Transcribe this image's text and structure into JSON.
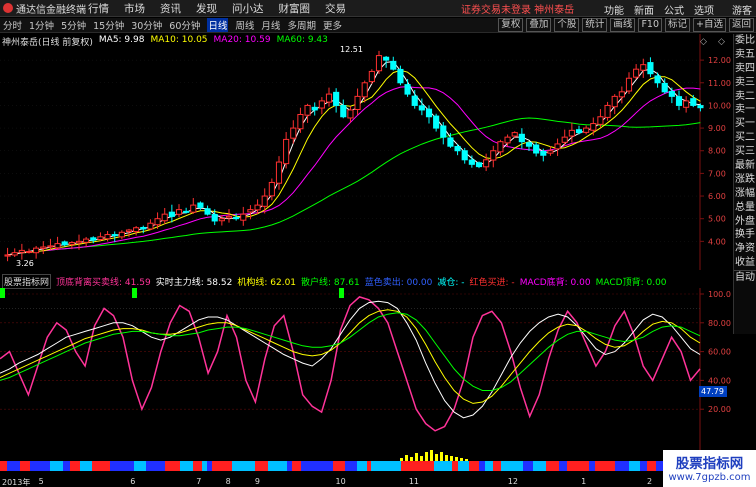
{
  "topbar": {
    "app_name": "通达信金融终端",
    "menu": [
      "行情",
      "市场",
      "资讯",
      "发现",
      "问小达",
      "财富圈",
      "交易"
    ],
    "notice": "证券交易未登录  神州泰岳",
    "right": [
      "功能",
      "新面",
      "公式",
      "选项",
      "游客"
    ]
  },
  "toolbar": {
    "periods": [
      "分时",
      "1分钟",
      "5分钟",
      "15分钟",
      "30分钟",
      "60分钟",
      "日线",
      "周线",
      "月线",
      "多周期",
      "更多"
    ],
    "selected_period": "日线",
    "tools": [
      "复权",
      "叠加",
      "个股",
      "统计",
      "画线",
      "F10",
      "标记",
      "+自选",
      "返回"
    ]
  },
  "main": {
    "stock_title": "神州泰岳(日线 前复权)",
    "ma": [
      {
        "label": "MA5: 9.98",
        "color": "#ffffff"
      },
      {
        "label": "MA10: 10.05",
        "color": "#ffff00"
      },
      {
        "label": "MA20: 10.59",
        "color": "#ff00ff"
      },
      {
        "label": "MA60: 9.43",
        "color": "#00ff00"
      }
    ],
    "high_label": "12.51",
    "low_label": "3.26",
    "y_ticks": [
      "12.00",
      "11.00",
      "10.00",
      "9.00",
      "8.00",
      "7.00",
      "6.00",
      "5.00",
      "4.00"
    ]
  },
  "indicator": {
    "name": "股票指标网",
    "items": [
      {
        "label": "顶底背离买卖线: 41.59",
        "color": "#ff3399"
      },
      {
        "label": "实时主力线: 58.52",
        "color": "#ffffff"
      },
      {
        "label": "机构线: 62.01",
        "color": "#ffff00"
      },
      {
        "label": "散户线: 87.61",
        "color": "#00ff00"
      },
      {
        "label": "蓝色卖出: 00.00",
        "color": "#3060ff"
      },
      {
        "label": "减仓: -",
        "color": "#00ffff"
      },
      {
        "label": "红色买进: -",
        "color": "#ff3030"
      },
      {
        "label": "MACD底背: 0.00",
        "color": "#ff00ff"
      },
      {
        "label": "MACD顶背: 0.00",
        "color": "#00ff00"
      }
    ],
    "y_ticks": [
      "100.0",
      "80.00",
      "60.00",
      "40.00",
      "20.00"
    ],
    "current_value": "47.79"
  },
  "sidebar": [
    "委比",
    "卖五",
    "卖四",
    "卖三",
    "卖二",
    "卖一",
    "买一",
    "买二",
    "买三",
    "最新",
    "涨跌",
    "涨幅",
    "总量",
    "外盘",
    "换手",
    "净资",
    "收益",
    "自动"
  ],
  "date_axis": [
    {
      "label": "2013年",
      "pos": 0.0
    },
    {
      "label": "5",
      "pos": 0.05
    },
    {
      "label": "6",
      "pos": 0.175
    },
    {
      "label": "7",
      "pos": 0.265
    },
    {
      "label": "8",
      "pos": 0.305
    },
    {
      "label": "9",
      "pos": 0.345
    },
    {
      "label": "10",
      "pos": 0.455
    },
    {
      "label": "11",
      "pos": 0.555
    },
    {
      "label": "12",
      "pos": 0.69
    },
    {
      "label": "1",
      "pos": 0.79
    },
    {
      "label": "2",
      "pos": 0.88
    }
  ],
  "watermark": {
    "title": "股票指标网",
    "url": "www.7gpzb.com"
  },
  "colors": {
    "up": "#ff3030",
    "down": "#00ffff",
    "ma5": "#ffffff",
    "ma10": "#ffff00",
    "ma20": "#ff00ff",
    "ma60": "#00ff00",
    "bg": "#000000"
  },
  "chart_data": [
    {
      "type": "candlestick",
      "ylim": [
        3.0,
        12.8
      ],
      "close": [
        3.4,
        3.5,
        3.6,
        3.55,
        3.7,
        3.75,
        3.8,
        3.9,
        3.85,
        3.95,
        4.0,
        4.1,
        4.05,
        4.2,
        4.3,
        4.25,
        4.4,
        4.5,
        4.6,
        4.55,
        4.8,
        5.0,
        5.2,
        5.1,
        5.4,
        5.3,
        5.6,
        5.5,
        5.2,
        4.9,
        5.0,
        5.1,
        5.0,
        5.2,
        5.4,
        5.6,
        6.0,
        6.6,
        7.5,
        8.5,
        9.0,
        9.6,
        10.0,
        9.8,
        10.2,
        10.5,
        10.0,
        9.5,
        9.8,
        10.4,
        11.0,
        11.5,
        12.2,
        12.0,
        11.6,
        11.0,
        10.5,
        10.0,
        9.8,
        9.5,
        9.0,
        8.6,
        8.2,
        8.0,
        7.6,
        7.4,
        7.3,
        7.6,
        8.0,
        8.4,
        8.6,
        8.8,
        8.4,
        8.2,
        7.9,
        7.8,
        8.0,
        8.3,
        8.6,
        8.9,
        8.8,
        9.0,
        9.2,
        9.5,
        10.0,
        10.4,
        10.6,
        11.2,
        11.6,
        11.8,
        11.4,
        11.0,
        10.6,
        10.4,
        10.0,
        10.2,
        10.0,
        9.9
      ]
    },
    {
      "type": "line",
      "ylim": [
        0,
        100
      ],
      "series": [
        {
          "name": "顶底背离买卖线",
          "values": [
            55,
            60,
            45,
            30,
            50,
            70,
            80,
            75,
            60,
            50,
            78,
            90,
            85,
            70,
            40,
            20,
            35,
            60,
            80,
            92,
            88,
            70,
            45,
            60,
            85,
            70,
            40,
            25,
            55,
            78,
            85,
            60,
            30,
            22,
            18,
            40,
            75,
            92,
            98,
            96,
            90,
            80,
            60,
            40,
            20,
            10,
            5,
            8,
            20,
            40,
            70,
            85,
            88,
            80,
            60,
            35,
            15,
            30,
            55,
            75,
            88,
            80,
            65,
            50,
            60,
            78,
            88,
            72,
            50,
            40,
            55,
            70,
            60,
            40,
            48
          ]
        },
        {
          "name": "实时主力线",
          "values": [
            45,
            48,
            52,
            55,
            58,
            62,
            66,
            70,
            72,
            74,
            76,
            78,
            80,
            80,
            78,
            74,
            70,
            68,
            70,
            74,
            78,
            82,
            84,
            84,
            82,
            78,
            74,
            70,
            66,
            62,
            58,
            55,
            52,
            50,
            55,
            62,
            72,
            82,
            90,
            94,
            95,
            94,
            90,
            80,
            68,
            52,
            38,
            26,
            18,
            14,
            16,
            22,
            32,
            44,
            56,
            66,
            74,
            80,
            84,
            86,
            84,
            78,
            70,
            62,
            58,
            60,
            66,
            74,
            82,
            86,
            84,
            78,
            70,
            62,
            58
          ]
        },
        {
          "name": "机构线",
          "values": [
            42,
            45,
            48,
            51,
            54,
            57,
            60,
            63,
            66,
            69,
            71,
            73,
            75,
            76,
            76,
            75,
            73,
            72,
            72,
            73,
            75,
            77,
            79,
            80,
            80,
            78,
            75,
            72,
            69,
            66,
            63,
            60,
            58,
            57,
            58,
            61,
            66,
            73,
            80,
            85,
            88,
            89,
            88,
            84,
            76,
            65,
            53,
            42,
            33,
            27,
            24,
            25,
            29,
            36,
            44,
            52,
            60,
            67,
            73,
            77,
            79,
            78,
            74,
            69,
            65,
            63,
            64,
            68,
            74,
            79,
            81,
            80,
            76,
            70,
            66
          ]
        },
        {
          "name": "散户线",
          "values": [
            40,
            42,
            45,
            48,
            51,
            54,
            57,
            60,
            63,
            66,
            68,
            70,
            72,
            73,
            74,
            74,
            73,
            72,
            71,
            71,
            72,
            73,
            75,
            76,
            77,
            77,
            76,
            74,
            72,
            70,
            68,
            66,
            64,
            63,
            63,
            64,
            66,
            70,
            75,
            80,
            84,
            86,
            87,
            86,
            82,
            75,
            66,
            57,
            48,
            41,
            36,
            33,
            33,
            35,
            39,
            45,
            51,
            57,
            63,
            68,
            72,
            74,
            74,
            72,
            70,
            68,
            67,
            68,
            70,
            74,
            77,
            78,
            77,
            74,
            71
          ]
        }
      ]
    }
  ]
}
